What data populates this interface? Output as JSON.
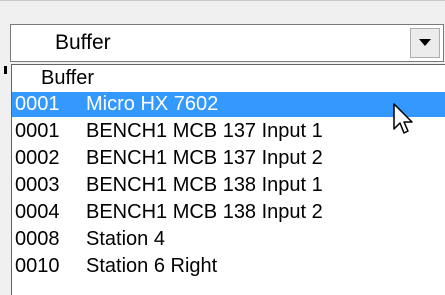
{
  "combo": {
    "selected_value": "Buffer",
    "button_icon": "chevron-down-icon"
  },
  "dropdown": {
    "items": [
      {
        "code": "",
        "name": "Buffer",
        "selected": false
      },
      {
        "code": "0001",
        "name": "Micro HX 7602",
        "selected": true
      },
      {
        "code": "0001",
        "name": "BENCH1 MCB 137 Input 1",
        "selected": false
      },
      {
        "code": "0002",
        "name": "BENCH1 MCB 137 Input 2",
        "selected": false
      },
      {
        "code": "0003",
        "name": "BENCH1 MCB 138 Input 1",
        "selected": false
      },
      {
        "code": "0004",
        "name": "BENCH1 MCB 138 Input 2",
        "selected": false
      },
      {
        "code": "0008",
        "name": "Station 4",
        "selected": false
      },
      {
        "code": "0010",
        "name": "Station 6 Right",
        "selected": false
      }
    ]
  },
  "colors": {
    "selection": "#3399ff",
    "selection_text": "#ffffff"
  },
  "cursor": {
    "icon": "mouse-pointer-icon"
  }
}
